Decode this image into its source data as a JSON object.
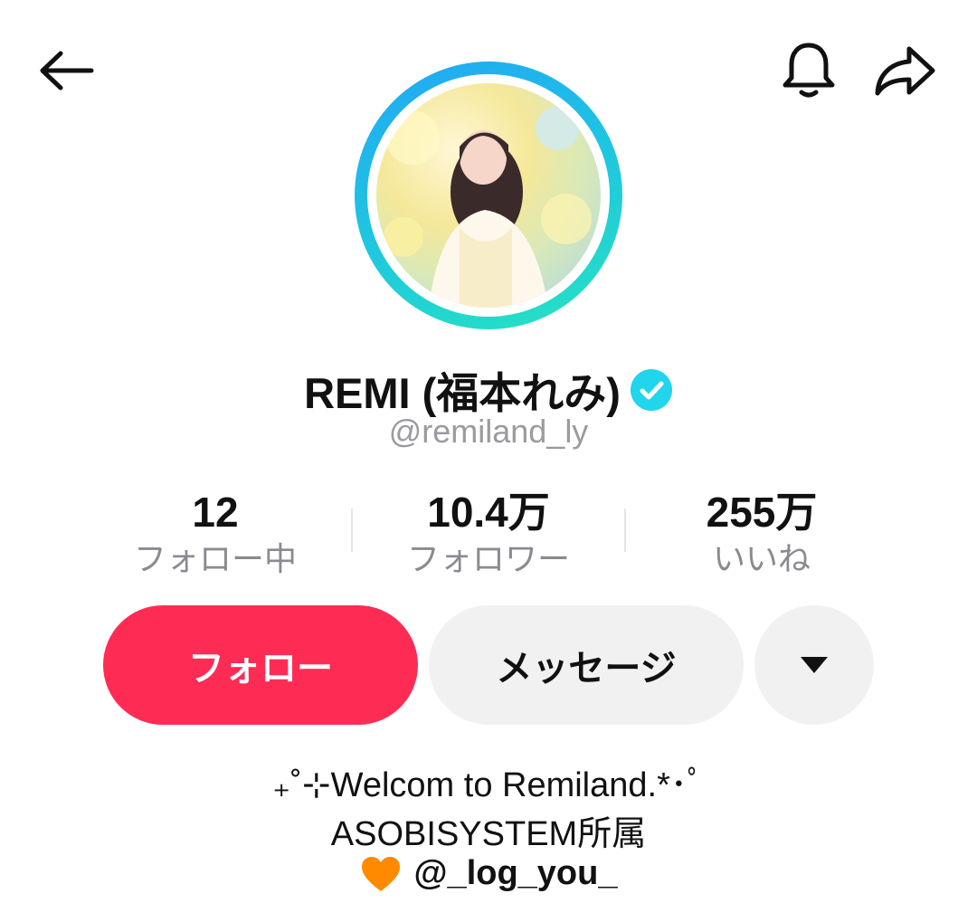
{
  "header": {
    "back_icon": "back-arrow-icon",
    "bell_icon": "bell-icon",
    "share_icon": "share-icon"
  },
  "profile": {
    "display_name": "REMI (福本れみ)",
    "verified": true,
    "handle": "@remiland_ly",
    "avatar_ring_colors": [
      "#20a7f5",
      "#26e3c0"
    ]
  },
  "stats": [
    {
      "value": "12",
      "label": "フォロー中"
    },
    {
      "value": "10.4万",
      "label": "フォロワー"
    },
    {
      "value": "255万",
      "label": "いいね"
    }
  ],
  "actions": {
    "follow_label": "フォロー",
    "message_label": "メッセージ",
    "more_icon": "caret-down-icon",
    "follow_color": "#fe2c55"
  },
  "bio": {
    "line1": "₊˚⊹Welcom to Remiland.*･ﾟ",
    "line2": "ASOBISYSTEM所属",
    "link_icon": "orange-heart-icon",
    "link_text": "@_log_you_"
  }
}
